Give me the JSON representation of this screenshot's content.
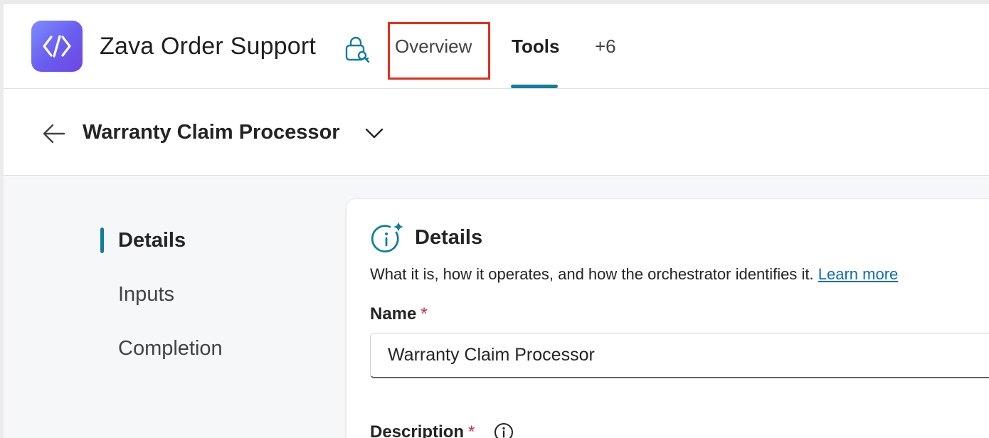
{
  "header": {
    "app_title": "Zava Order Support",
    "tabs": [
      {
        "label": "Overview",
        "active": false,
        "highlighted": true
      },
      {
        "label": "Tools",
        "active": true
      },
      {
        "label": "+6",
        "active": false
      }
    ]
  },
  "sub_header": {
    "title": "Warranty Claim Processor"
  },
  "nav": {
    "items": [
      {
        "label": "Details",
        "active": true
      },
      {
        "label": "Inputs",
        "active": false
      },
      {
        "label": "Completion",
        "active": false
      }
    ]
  },
  "details_card": {
    "title": "Details",
    "description": "What it is, how it operates, and how the orchestrator identifies it.",
    "learn_more": "Learn more",
    "fields": {
      "name_label": "Name",
      "name_value": "Warranty Claim Processor",
      "required_marker": "*",
      "description_label": "Description"
    }
  },
  "colors": {
    "accent": "#117d9e",
    "highlight_border": "#e2301a",
    "link": "#0f6cbd",
    "required": "#c4314b",
    "logo_gradient_start": "#7d8cff",
    "logo_gradient_end": "#6f46e2"
  },
  "icons": [
    "app-logo-icon",
    "lock-key-icon",
    "back-arrow-icon",
    "chevron-down-icon",
    "info-sparkle-icon",
    "info-icon"
  ]
}
